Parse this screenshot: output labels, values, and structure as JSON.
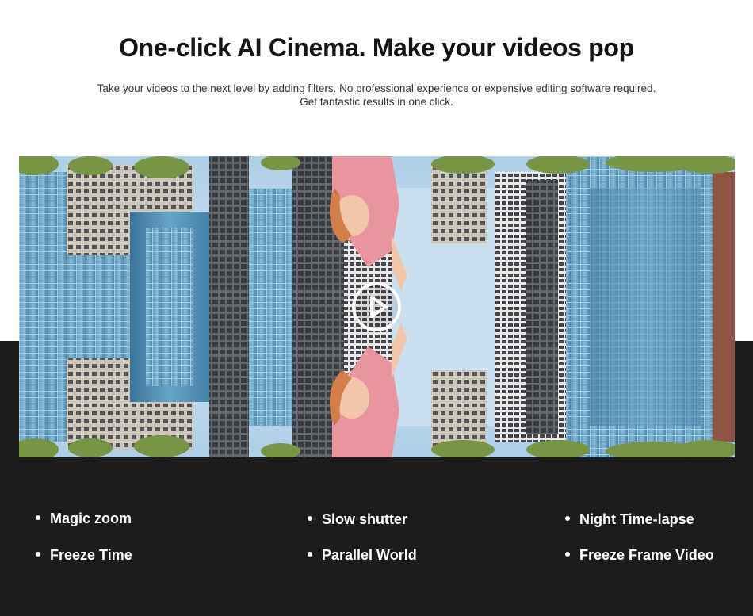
{
  "header": {
    "title": "One-click AI Cinema. Make your videos pop",
    "subtitle_line1": "Take your videos to the next level by adding filters. No professional experience or expensive editing software required.",
    "subtitle_line2": "Get fantastic results in one click."
  },
  "video": {
    "play_icon": "play-icon"
  },
  "features": [
    {
      "label": "Magic zoom"
    },
    {
      "label": "Slow shutter"
    },
    {
      "label": "Night Time-lapse"
    },
    {
      "label": "Freeze Time"
    },
    {
      "label": "Parallel World"
    },
    {
      "label": "Freeze Frame Video"
    }
  ],
  "colors": {
    "dark_band": "#1c1c1c",
    "title": "#141414",
    "text": "#333333"
  }
}
